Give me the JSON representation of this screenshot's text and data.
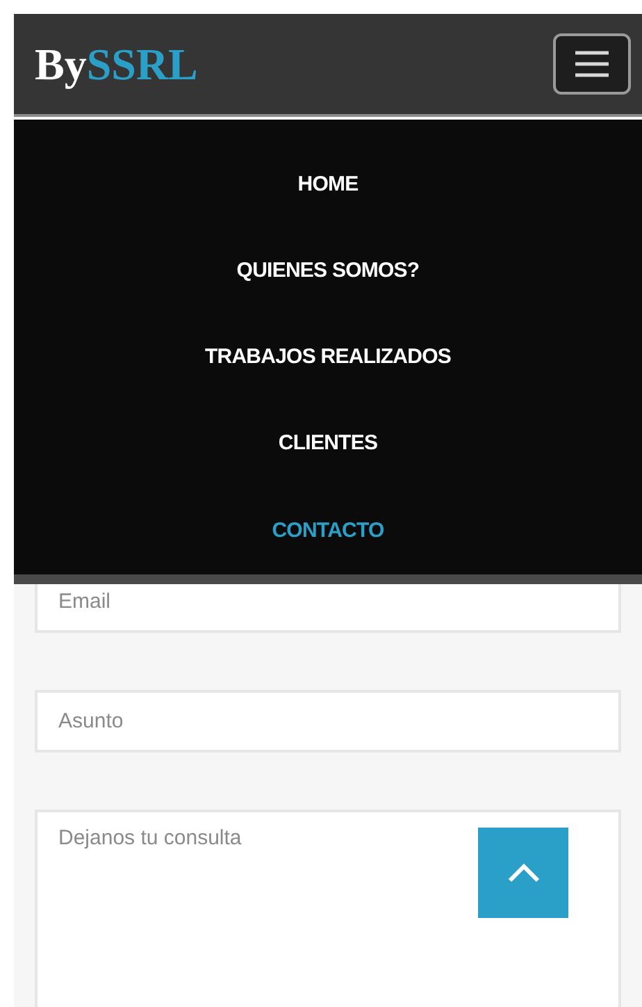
{
  "header": {
    "logo_prefix": "By",
    "logo_suffix": "SSRL"
  },
  "menu": {
    "expanded": true,
    "items": [
      {
        "label": "HOME",
        "selected": false
      },
      {
        "label": "QUIENES SOMOS?",
        "selected": false
      },
      {
        "label": "TRABAJOS REALIZADOS",
        "selected": false
      },
      {
        "label": "CLIENTES",
        "selected": false
      },
      {
        "label": "CONTACTO",
        "selected": true
      }
    ]
  },
  "form": {
    "fields": [
      {
        "kind": "input",
        "placeholder": "Email"
      },
      {
        "kind": "input",
        "placeholder": "Asunto"
      },
      {
        "kind": "textarea",
        "placeholder": "Dejanos tu consulta"
      }
    ]
  }
}
